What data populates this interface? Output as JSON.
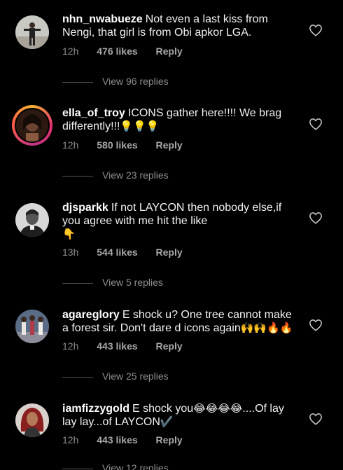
{
  "comments": [
    {
      "username": "nhn_nwabueze",
      "text": "Not even a last kiss from Nengi, that girl is from Obi apkor LGA.",
      "emoji": "",
      "time": "12h",
      "likes": "476 likes",
      "reply": "Reply",
      "replies": "View 96 replies",
      "avatar": "person-standing-photo",
      "liked": false
    },
    {
      "username": "ella_of_troy",
      "text": "ICONS gather here!!!! We brag differently!!!",
      "emoji": "💡💡💡",
      "time": "12h",
      "likes": "580 likes",
      "reply": "Reply",
      "replies": "View 23 replies",
      "avatar": "woman-portrait-with-story-ring",
      "liked": false
    },
    {
      "username": "djsparkk",
      "text": "If not LAYCON then nobody else,if you agree with me hit the like",
      "emoji": "👇",
      "time": "13h",
      "likes": "544 likes",
      "reply": "Reply",
      "replies": "View 5 replies",
      "avatar": "man-portrait-black-and-white",
      "liked": false
    },
    {
      "username": "agareglory",
      "text": "E shock u? One tree cannot make a forest sir. Don't dare d icons again",
      "emoji": "🙌🙌🔥🔥",
      "time": "12h",
      "likes": "443 likes",
      "reply": "Reply",
      "replies": "View 25 replies",
      "avatar": "group-photo",
      "liked": false
    },
    {
      "username": "iamfizzygold",
      "text_before": "E shock you",
      "emoji_mid": "😂😂😂😂",
      "text_after": "....Of lay lay lay...of LAYCON",
      "emoji_end": "✔️",
      "time": "12h",
      "likes": "443 likes",
      "reply": "Reply",
      "replies": "View 12 replies",
      "avatar": "woman-portrait-red-hair",
      "liked": false
    }
  ],
  "colors": {
    "background": "#000000",
    "text": "#f2f2f2",
    "muted": "#8e8e8e",
    "heart": "#d0d0d0"
  }
}
